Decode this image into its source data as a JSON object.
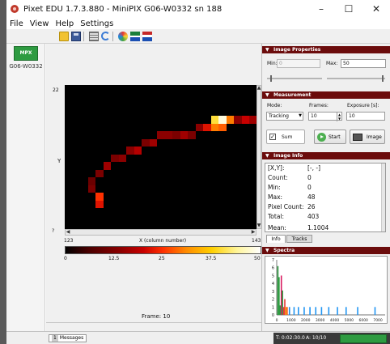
{
  "window": {
    "title": "Pixet EDU 1.7.3.880 - MiniPIX G06-W0332 sn 188",
    "minimize": "–",
    "maximize": "☐",
    "close": "✕"
  },
  "menu": [
    "File",
    "View",
    "Help",
    "Settings"
  ],
  "device": {
    "chip_label": "MPX",
    "name": "G06-W0332"
  },
  "image": {
    "y_tick_top": "22",
    "y_label": "Y",
    "y_tick_bottom": "?",
    "x_tick_min": "123",
    "x_label": "X (column number)",
    "x_tick_max": "143",
    "colorbar_ticks": [
      "0",
      "12.5",
      "25",
      "37.5",
      "50"
    ],
    "frame_label": "Frame: 10",
    "pixels": [
      {
        "c": 19,
        "r": 4,
        "v": 40
      },
      {
        "c": 20,
        "r": 4,
        "v": 48
      },
      {
        "c": 21,
        "r": 4,
        "v": 30
      },
      {
        "c": 22,
        "r": 4,
        "v": 14
      },
      {
        "c": 23,
        "r": 4,
        "v": 20
      },
      {
        "c": 24,
        "r": 4,
        "v": 16
      },
      {
        "c": 17,
        "r": 5,
        "v": 14
      },
      {
        "c": 18,
        "r": 5,
        "v": 22
      },
      {
        "c": 19,
        "r": 5,
        "v": 30
      },
      {
        "c": 20,
        "r": 5,
        "v": 28
      },
      {
        "c": 12,
        "r": 6,
        "v": 14
      },
      {
        "c": 13,
        "r": 6,
        "v": 14
      },
      {
        "c": 14,
        "r": 6,
        "v": 12
      },
      {
        "c": 15,
        "r": 6,
        "v": 16
      },
      {
        "c": 16,
        "r": 6,
        "v": 12
      },
      {
        "c": 10,
        "r": 7,
        "v": 12
      },
      {
        "c": 11,
        "r": 7,
        "v": 16
      },
      {
        "c": 8,
        "r": 8,
        "v": 14
      },
      {
        "c": 9,
        "r": 8,
        "v": 18
      },
      {
        "c": 6,
        "r": 9,
        "v": 12
      },
      {
        "c": 7,
        "r": 9,
        "v": 14
      },
      {
        "c": 5,
        "r": 10,
        "v": 16
      },
      {
        "c": 4,
        "r": 11,
        "v": 12
      },
      {
        "c": 3,
        "r": 12,
        "v": 10
      },
      {
        "c": 3,
        "r": 13,
        "v": 12
      },
      {
        "c": 4,
        "r": 14,
        "v": 25
      },
      {
        "c": 4,
        "r": 15,
        "v": 22
      }
    ],
    "value_max": 50
  },
  "image_properties": {
    "header": "Image Properties",
    "min_label": "Min:",
    "min_value": "0",
    "max_label": "Max:",
    "max_value": "50"
  },
  "measurement": {
    "header": "Measurement",
    "mode_label": "Mode:",
    "mode_value": "Tracking",
    "frames_label": "Frames:",
    "frames_value": "10",
    "exposure_label": "Exposure [s]:",
    "exposure_value": "10",
    "sum_label": "Sum",
    "sum_checked": "✓",
    "start_label": "Start",
    "image_label": "Image"
  },
  "image_info": {
    "header": "Image Info",
    "rows": [
      {
        "label": "[X,Y]:",
        "value": "[-, -]"
      },
      {
        "label": "Count:",
        "value": "0"
      },
      {
        "label": "Min:",
        "value": "0"
      },
      {
        "label": "Max:",
        "value": "48"
      },
      {
        "label": "Pixel Count:",
        "value": "26"
      },
      {
        "label": "Total:",
        "value": "403"
      },
      {
        "label": "Mean:",
        "value": "1.1004"
      }
    ],
    "tabs": [
      "Info",
      "Tracks"
    ]
  },
  "spectra": {
    "header": "Spectra",
    "y_ticks": [
      "0",
      "1",
      "2",
      "3",
      "4",
      "5",
      "6",
      "7"
    ],
    "x_ticks": [
      "0",
      "1000",
      "2000",
      "3000",
      "4000",
      "5000",
      "6000",
      "7000"
    ],
    "xlim": [
      0,
      7500
    ],
    "ylim": [
      0,
      7
    ],
    "bars": [
      {
        "x": 80,
        "y": 6.2,
        "color": "#2e9b41"
      },
      {
        "x": 160,
        "y": 4.8,
        "color": "#2e9b41"
      },
      {
        "x": 240,
        "y": 1.2,
        "color": "#2e9b41"
      },
      {
        "x": 320,
        "y": 5.0,
        "color": "#d81b60"
      },
      {
        "x": 400,
        "y": 3.1,
        "color": "#2e9b41"
      },
      {
        "x": 480,
        "y": 1.0,
        "color": "#e53935"
      },
      {
        "x": 560,
        "y": 2.0,
        "color": "#e53935"
      },
      {
        "x": 640,
        "y": 1.0,
        "color": "#ffb300"
      },
      {
        "x": 720,
        "y": 1.0,
        "color": "#f4511e"
      },
      {
        "x": 880,
        "y": 1.0,
        "color": "#1e88e5"
      },
      {
        "x": 1200,
        "y": 1.0,
        "color": "#2196f3"
      },
      {
        "x": 1500,
        "y": 1.0,
        "color": "#2196f3"
      },
      {
        "x": 1900,
        "y": 1.0,
        "color": "#2196f3"
      },
      {
        "x": 2300,
        "y": 1.0,
        "color": "#2196f3"
      },
      {
        "x": 2700,
        "y": 1.0,
        "color": "#2196f3"
      },
      {
        "x": 3100,
        "y": 1.0,
        "color": "#2196f3"
      },
      {
        "x": 3600,
        "y": 1.0,
        "color": "#2196f3"
      },
      {
        "x": 4200,
        "y": 1.0,
        "color": "#2196f3"
      },
      {
        "x": 4800,
        "y": 1.0,
        "color": "#2196f3"
      },
      {
        "x": 5600,
        "y": 1.0,
        "color": "#2196f3"
      },
      {
        "x": 6800,
        "y": 1.0,
        "color": "#2196f3"
      }
    ]
  },
  "status": {
    "messages_count": "1",
    "messages_label": "Messages",
    "time": "T: 0:02:30.0",
    "acq": "A: 10/10",
    "progress": 1.0
  },
  "colors": {
    "section_header": "#6b0c0c",
    "device_green": "#2e9b41",
    "progress_green": "#2e9b41"
  }
}
